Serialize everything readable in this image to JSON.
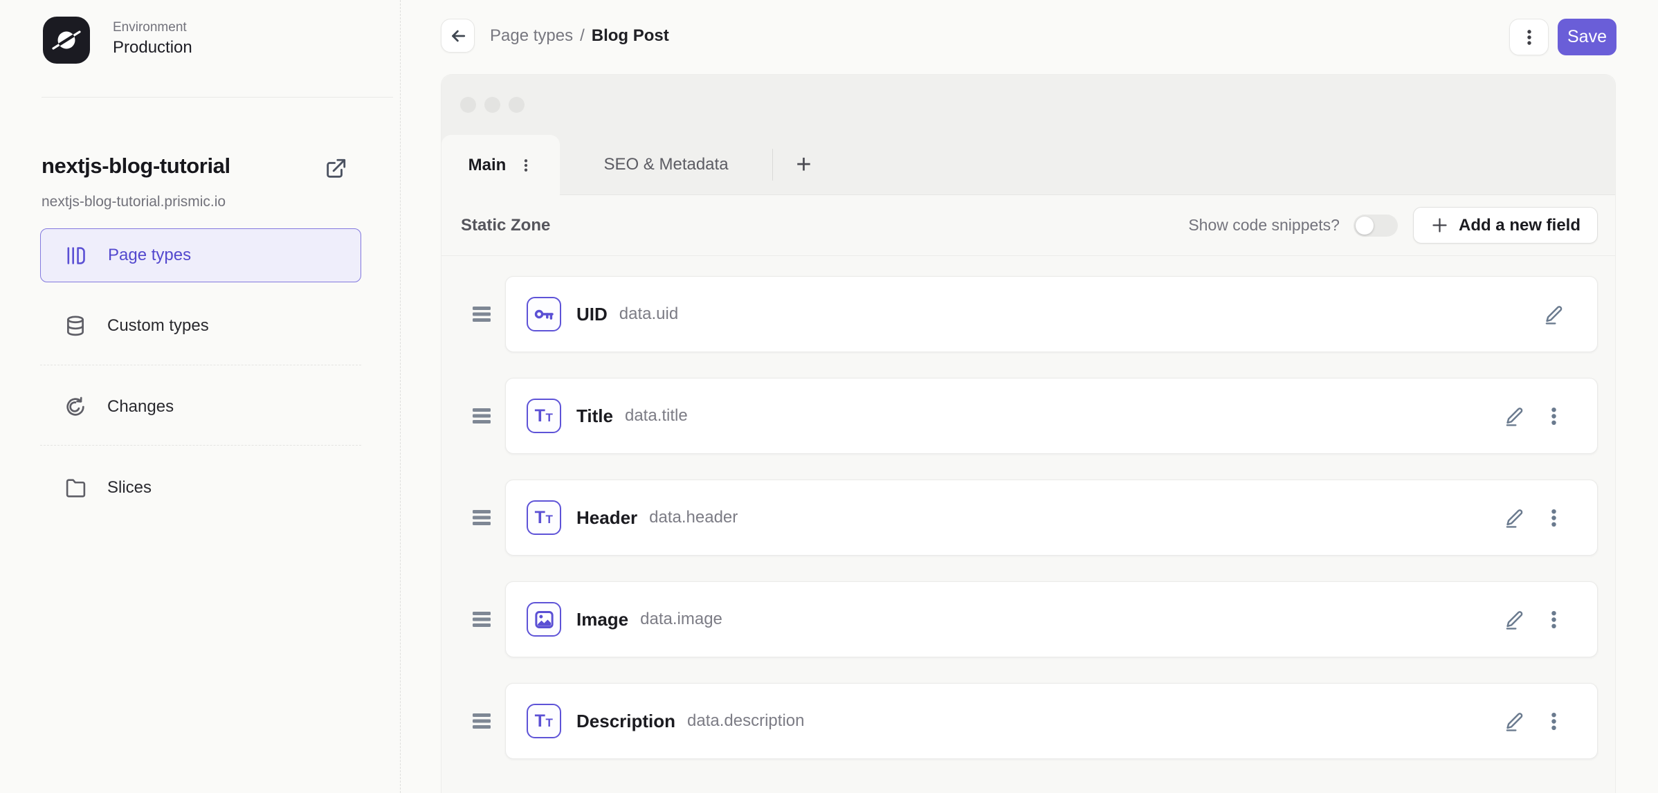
{
  "colors": {
    "accent": "#5B50D4",
    "save_button": "#6A5ED8",
    "active_nav_bg": "#EFEEFB"
  },
  "sidebar": {
    "environment": {
      "label": "Environment",
      "value": "Production"
    },
    "repo": {
      "name": "nextjs-blog-tutorial",
      "domain": "nextjs-blog-tutorial.prismic.io"
    },
    "items": [
      {
        "label": "Page types",
        "icon": "page-types-icon",
        "active": true
      },
      {
        "label": "Custom types",
        "icon": "custom-types-icon",
        "active": false
      },
      {
        "label": "Changes",
        "icon": "changes-icon",
        "active": false
      },
      {
        "label": "Slices",
        "icon": "slices-icon",
        "active": false
      }
    ]
  },
  "header": {
    "breadcrumb": {
      "parent": "Page types",
      "separator": "/",
      "current": "Blog Post"
    },
    "save_label": "Save"
  },
  "editor": {
    "tabs": [
      {
        "label": "Main",
        "active": true
      },
      {
        "label": "SEO & Metadata",
        "active": false
      }
    ],
    "add_tab_label": "+",
    "toolbar": {
      "zone_title": "Static Zone",
      "snippets_label": "Show code snippets?",
      "snippets_enabled": false,
      "add_field_label": "Add a new field"
    },
    "fields": [
      {
        "name": "UID",
        "api_id": "data.uid",
        "icon": "key-icon",
        "has_menu": false
      },
      {
        "name": "Title",
        "api_id": "data.title",
        "icon": "text-icon",
        "has_menu": true
      },
      {
        "name": "Header",
        "api_id": "data.header",
        "icon": "text-icon",
        "has_menu": true
      },
      {
        "name": "Image",
        "api_id": "data.image",
        "icon": "image-icon",
        "has_menu": true
      },
      {
        "name": "Description",
        "api_id": "data.description",
        "icon": "text-icon",
        "has_menu": true
      }
    ]
  }
}
